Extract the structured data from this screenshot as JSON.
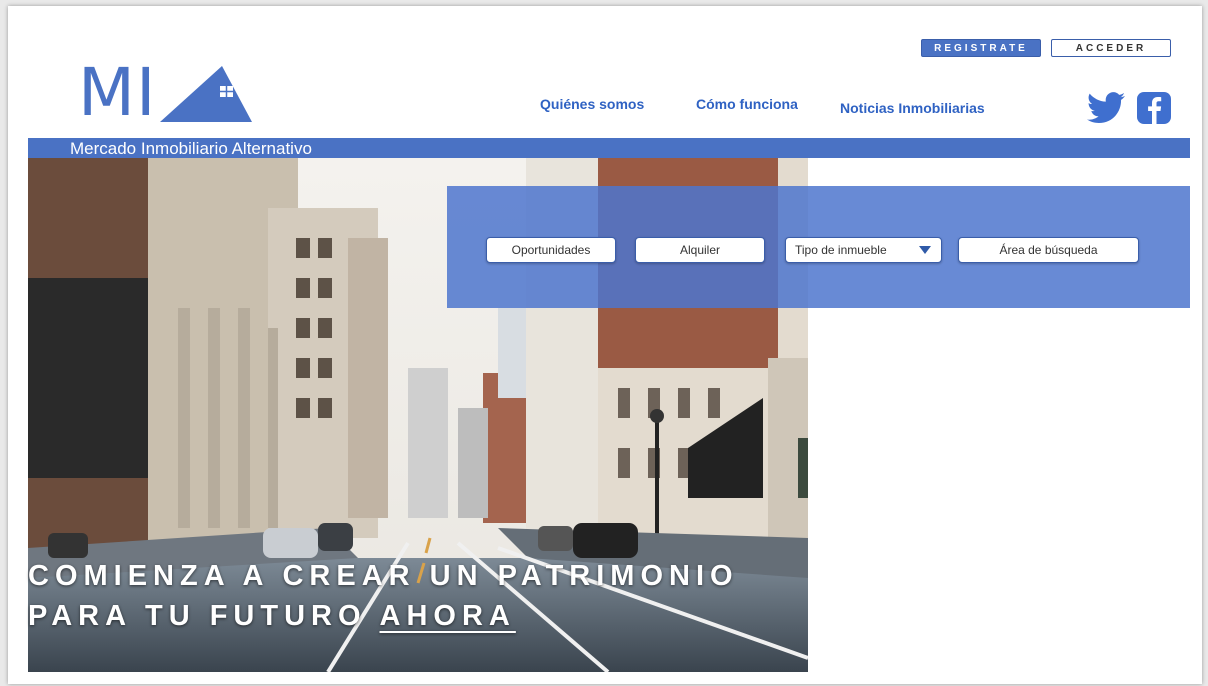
{
  "logo": {
    "text": "MI"
  },
  "header": {
    "register_label": "REGISTRATE",
    "login_label": "ACCEDER",
    "nav": [
      "Quiénes somos",
      "Cómo funciona",
      "Noticias Inmobiliarias"
    ],
    "social_icons": [
      "twitter-icon",
      "facebook-icon"
    ],
    "tagline": "Mercado Inmobiliario Alternativo"
  },
  "search": {
    "opportunities_label": "Oportunidades",
    "rent_label": "Alquiler",
    "property_type_label": "Tipo de inmueble",
    "search_area_label": "Área de búsqueda"
  },
  "hero": {
    "line1": "COMIENZA A CREAR UN PATRIMONIO",
    "line2_prefix": "PARA TU FUTURO ",
    "line2_emphasis": "AHORA"
  },
  "colors": {
    "brand": "#4a72c4",
    "nav_text": "#2f62c3",
    "panel": "#4e76ce"
  }
}
